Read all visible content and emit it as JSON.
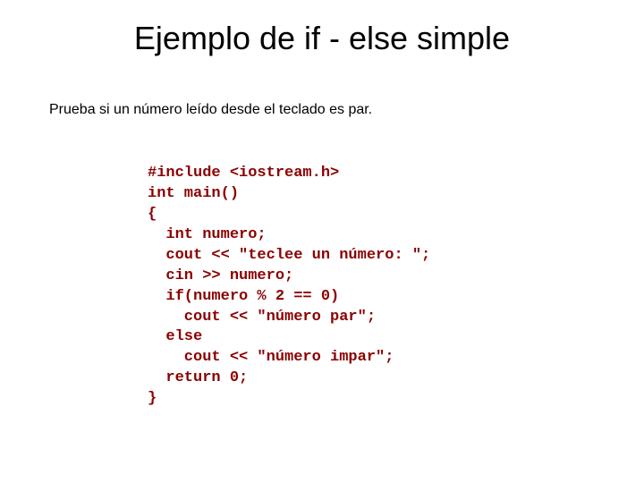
{
  "title": "Ejemplo de if - else simple",
  "subtitle": "Prueba si un número leído desde el teclado es par.",
  "code": {
    "l1": "#include <iostream.h>",
    "l2": "int main()",
    "l3": "{",
    "l4": "  int numero;",
    "l5": "  cout << \"teclee un número: \";",
    "l6": "  cin >> numero;",
    "l7": "  if(numero % 2 == 0)",
    "l8": "    cout << \"número par\";",
    "l9": "  else",
    "l10": "    cout << \"número impar\";",
    "l11": "  return 0;",
    "l12": "}"
  }
}
